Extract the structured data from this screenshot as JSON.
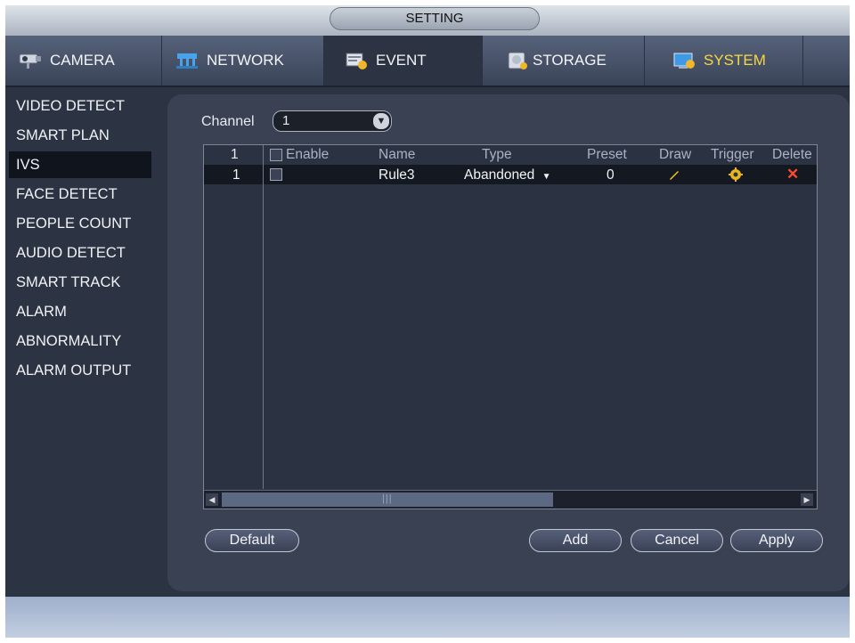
{
  "window": {
    "title": "SETTING"
  },
  "tabs": [
    {
      "label": "CAMERA",
      "icon": "camera-icon"
    },
    {
      "label": "NETWORK",
      "icon": "network-icon"
    },
    {
      "label": "EVENT",
      "icon": "event-icon"
    },
    {
      "label": "STORAGE",
      "icon": "storage-icon"
    },
    {
      "label": "SYSTEM",
      "icon": "system-icon"
    }
  ],
  "sidebar": {
    "items": [
      {
        "label": "VIDEO DETECT"
      },
      {
        "label": "SMART PLAN"
      },
      {
        "label": "IVS"
      },
      {
        "label": "FACE DETECT"
      },
      {
        "label": "PEOPLE COUNT"
      },
      {
        "label": "AUDIO DETECT"
      },
      {
        "label": "SMART TRACK"
      },
      {
        "label": "ALARM"
      },
      {
        "label": "ABNORMALITY"
      },
      {
        "label": "ALARM OUTPUT"
      }
    ],
    "selected": "IVS"
  },
  "channel": {
    "label": "Channel",
    "value": "1"
  },
  "table": {
    "headers": {
      "num": "1",
      "enable": "Enable",
      "name": "Name",
      "type": "Type",
      "preset": "Preset",
      "draw": "Draw",
      "trigger": "Trigger",
      "delete": "Delete"
    },
    "rows": [
      {
        "num": "1",
        "enable": false,
        "name": "Rule3",
        "type": "Abandoned",
        "preset": "0"
      }
    ]
  },
  "buttons": {
    "default": "Default",
    "add": "Add",
    "cancel": "Cancel",
    "apply": "Apply"
  },
  "colors": {
    "system_tab_text": "#f5d742",
    "draw_icon": "#f3c623",
    "trigger_icon": "#e8b51e",
    "delete_icon": "#ff4a2e"
  }
}
